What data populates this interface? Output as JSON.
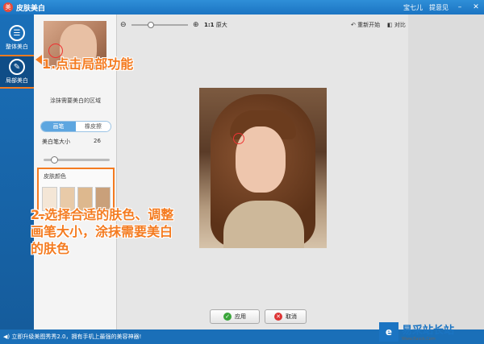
{
  "window": {
    "title": "皮肤美白",
    "user": "宝七儿",
    "feedback": "提意见",
    "app_logo": "美"
  },
  "nav": {
    "items": [
      {
        "label": "整体美白",
        "icon": "list-icon"
      },
      {
        "label": "局部美白",
        "icon": "brush-icon"
      }
    ]
  },
  "panel": {
    "hint": "涂抹需要美白的区域",
    "modes": [
      "画笔",
      "橡皮擦"
    ],
    "brush_size_label": "美白笔大小",
    "brush_size_value": "26",
    "brush_size_level": 0.26,
    "skin_color_title": "皮肤颜色",
    "swatches": [
      "#f4e6d6",
      "#e8caa8",
      "#ddb88e",
      "#c9a07a"
    ]
  },
  "toolbar": {
    "ratio_bold": "1:1",
    "ratio_label": "原大",
    "reset": "重新开始",
    "compare": "对比"
  },
  "actions": {
    "apply": "应用",
    "cancel": "取消"
  },
  "status": {
    "text": "立即升级美图秀秀2.0，拥有手机上最强的美容神器!"
  },
  "annotations": {
    "step1": "1.点击局部功能",
    "step2_lines": [
      "2.选择合适的肤色、调整",
      "画笔大小，涂抹需要美白",
      "的肤色"
    ]
  },
  "watermark": {
    "name": "易采站长站",
    "url": "Www.Easck.Com"
  },
  "colors": {
    "titlebar": "#1b74c2",
    "accent_orange": "#f47b20",
    "apply_green": "#3aa53a",
    "cancel_red": "#d33333"
  }
}
